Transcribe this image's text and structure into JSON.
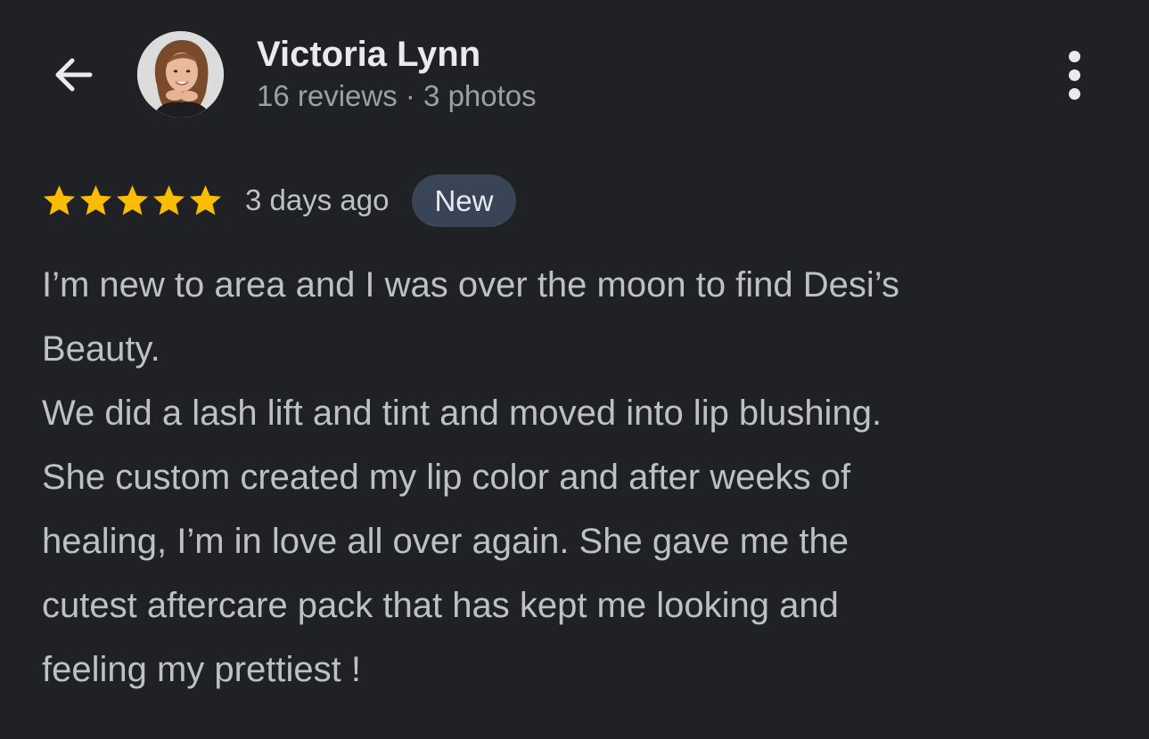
{
  "header": {
    "back_icon": "arrow-left-icon",
    "reviewer_name": "Victoria Lynn",
    "reviewer_stats": "16 reviews · 3 photos",
    "more_icon": "more-vert-icon"
  },
  "review": {
    "rating": 5,
    "rating_max": 5,
    "star_color": "#fbbc04",
    "time": "3 days ago",
    "badge": "New",
    "text_lines": [
      "I’m new to area and I was over the moon to find Desi’s",
      "Beauty.",
      "We did a lash lift and tint and moved into lip blushing.",
      "She custom created my lip color and after weeks of",
      "healing, I’m in love all over again. She gave me the",
      "cutest aftercare pack that has kept me looking and",
      "feeling my prettiest !"
    ]
  },
  "colors": {
    "background": "#202124",
    "primary_text": "#e8eaed",
    "secondary_text": "#9aa0a6",
    "badge_bg": "#394457"
  }
}
